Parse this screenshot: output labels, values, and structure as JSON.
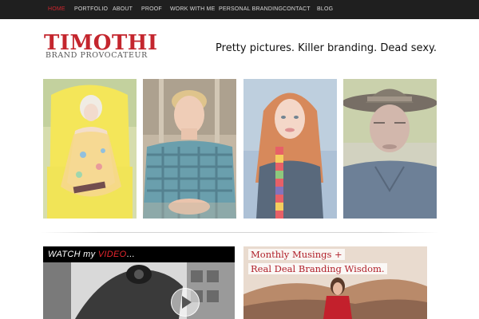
{
  "nav": {
    "items": [
      {
        "label": "HOME",
        "active": true
      },
      {
        "label": "PORTFOLIO"
      },
      {
        "label": "ABOUT"
      },
      {
        "label": "PROOF"
      },
      {
        "label": "WORK WITH ME"
      },
      {
        "label": "PERSONAL BRANDING"
      },
      {
        "label": "CONTACT"
      },
      {
        "label": "BLOG"
      }
    ],
    "active_color": "#d0262e"
  },
  "brand": {
    "name": "TIMOTHI",
    "subtitle": "BRAND PROVOCATEUR",
    "color": "#c4262e"
  },
  "tagline": "Pretty pictures. Killer branding. Dead sexy.",
  "video": {
    "title_part1": "WATCH my ",
    "title_part2": "VIDEO",
    "title_part3": "..."
  },
  "musings": {
    "line1": "Monthly Musings +",
    "line2": "Real Deal Branding Wisdom."
  }
}
